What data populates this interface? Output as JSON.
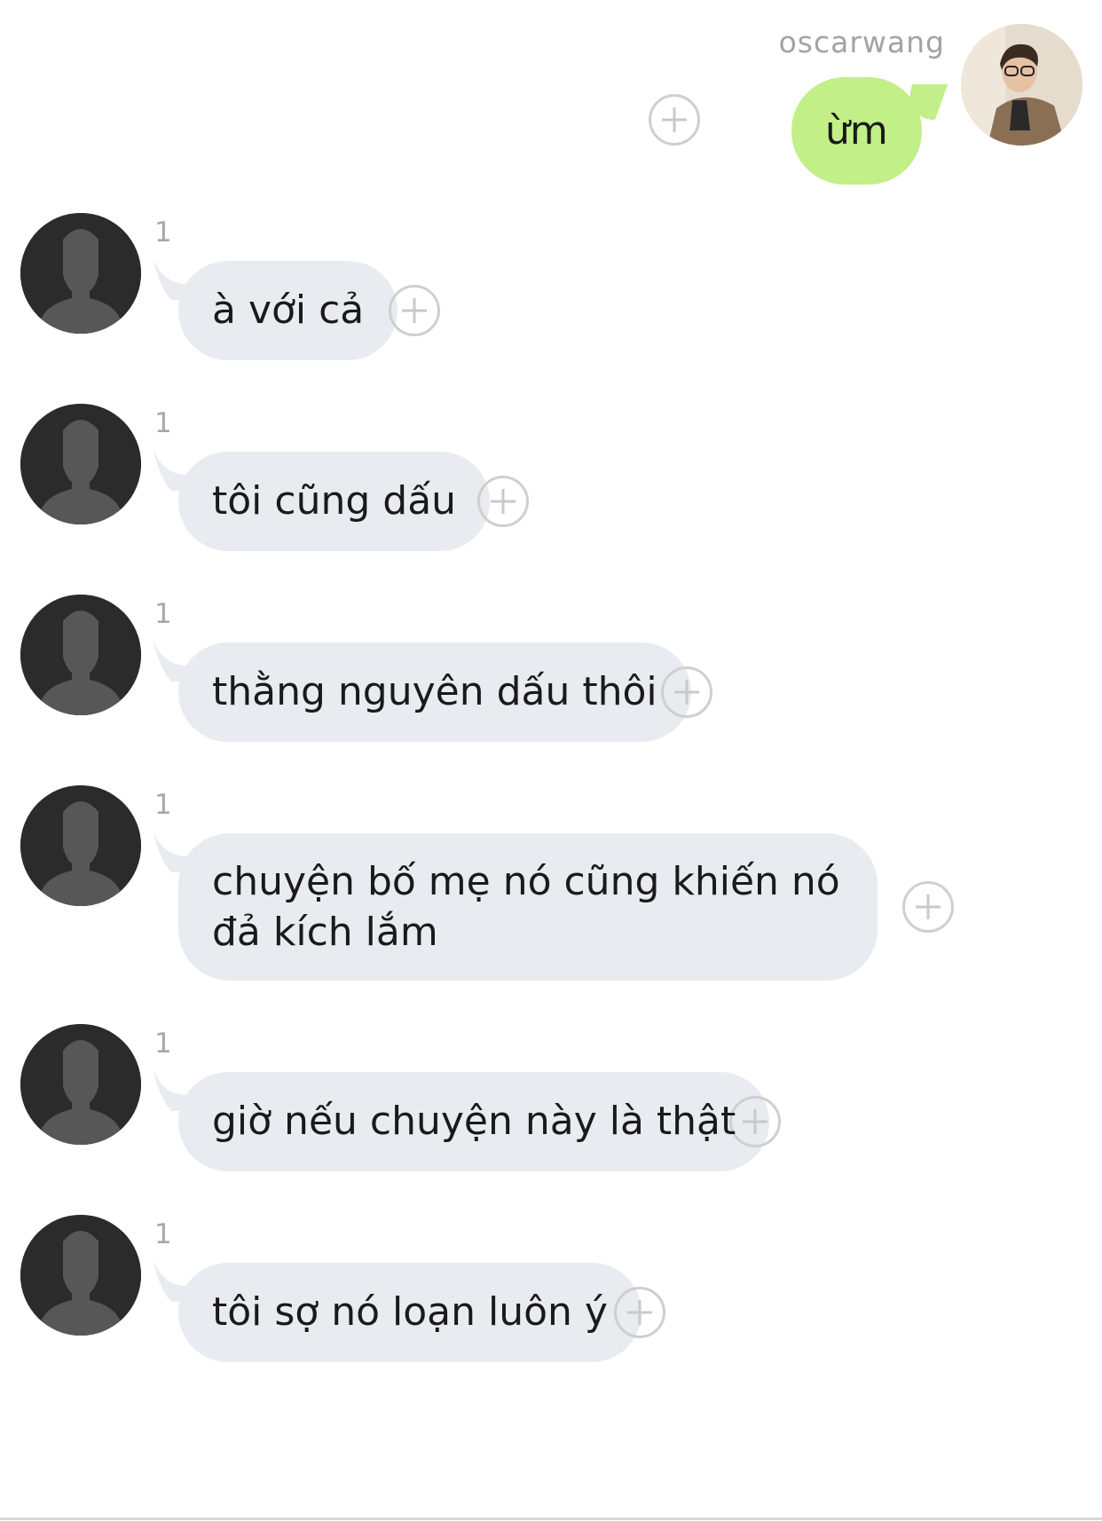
{
  "chat": {
    "outgoing": {
      "sender_name": "oscarwang",
      "text": "ừm"
    },
    "incoming": [
      {
        "unread_count": "1",
        "text": "à với cả"
      },
      {
        "unread_count": "1",
        "text": "tôi cũng dấu"
      },
      {
        "unread_count": "1",
        "text": "thằng nguyên dấu thôi"
      },
      {
        "unread_count": "1",
        "text": "chuyện bố mẹ nó cũng khiến nó đả kích lắm"
      },
      {
        "unread_count": "1",
        "text": "giờ nếu chuyện này là thật"
      },
      {
        "unread_count": "1",
        "text": "tôi sợ nó loạn luôn ý"
      }
    ]
  },
  "colors": {
    "outgoing_bubble": "#c2ef88",
    "incoming_bubble": "#e8ebef",
    "avatar_placeholder": "#2b2b2b"
  },
  "icons": {
    "add": "plus-circle-icon",
    "default_avatar": "person-silhouette-icon"
  }
}
